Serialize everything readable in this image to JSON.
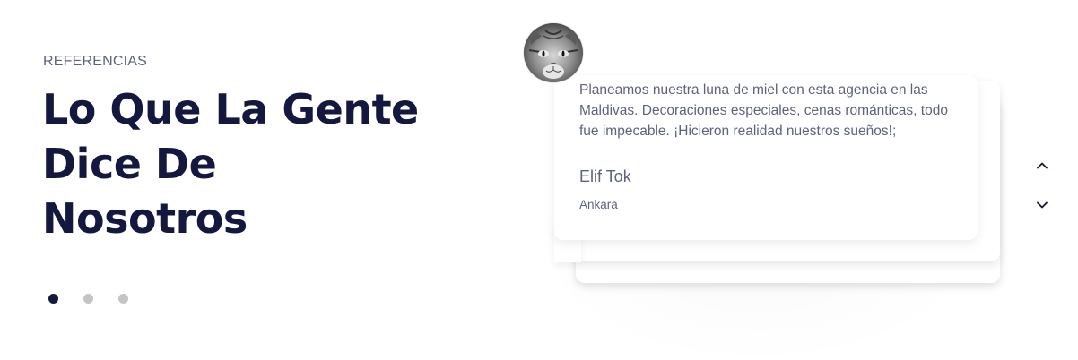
{
  "section": {
    "eyebrow": "REFERENCIAS",
    "headline_lines": [
      "Lo Que La Gente",
      "Dice De",
      "Nosotros"
    ]
  },
  "carousel": {
    "dots_count": 3,
    "active_dot_index": 0
  },
  "testimonial": {
    "quote": "Planeamos nuestra luna de miel con esta agencia en las Maldivas. Decoraciones especiales, cenas románticas, todo fue impecable. ¡Hicieron realidad nuestros sueños!;",
    "author": "Elif Tok",
    "location": "Ankara",
    "avatar_icon": "cat-avatar"
  },
  "controls": {
    "prev_icon": "chevron-up-icon",
    "next_icon": "chevron-down-icon"
  },
  "colors": {
    "heading": "#14183e",
    "text": "#5e6282",
    "dot_active": "#14183e",
    "dot_inactive": "#c4c4c4"
  }
}
